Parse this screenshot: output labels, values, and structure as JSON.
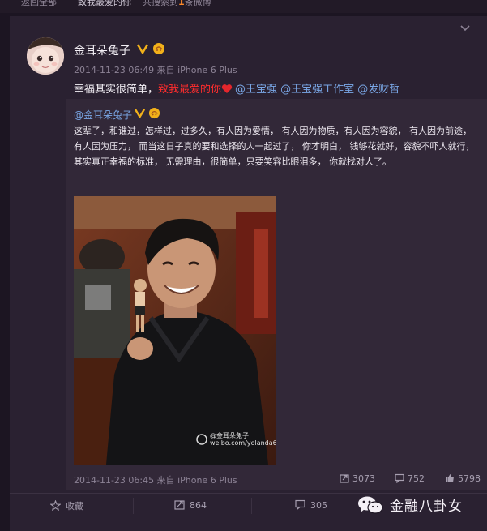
{
  "topbar": {
    "back_label": "返回全部",
    "crumb": "致我最爱的你",
    "count_prefix": "共搜索到",
    "count_value": "1",
    "count_suffix": "条微博"
  },
  "post": {
    "author": "金耳朵兔子",
    "meta": "2014-11-23 06:49 来自 iPhone 6 Plus",
    "text_plain": "幸福其实很简单，",
    "text_highlight": "致我最爱的你",
    "mentions": "@王宝强 @王宝强工作室 @发财哲"
  },
  "repost": {
    "author": "@金耳朵兔子",
    "text": "这辈子，和谁过，怎样过，过多久，有人因为爱情， 有人因为物质，有人因为容貌， 有人因为前途，有人因为压力， 而当这日子真的要和选择的人一起过了， 你才明白， 钱够花就好，容貌不吓人就行， 其实真正幸福的标准， 无需理由，很简单，只要笑容比眼泪多， 你就找对人了。",
    "photo_watermark_line1": "@金耳朵兔子",
    "photo_watermark_line2": "weibo.com/yolanda6",
    "meta": "2014-11-23 06:45 来自 iPhone 6 Plus",
    "reposts": "3073",
    "comments": "752",
    "likes": "5798"
  },
  "actions": {
    "favorite": "收藏",
    "repost_count": "864",
    "comment_count": "305"
  },
  "watermark": {
    "text": "金融八卦女"
  },
  "colors": {
    "background": "#1c1522",
    "card": "#2a2131",
    "repost_bg": "#322838",
    "highlight_red": "#ff2d2d",
    "link_blue": "#7aa7e6",
    "verified_gold": "#f2b11a"
  }
}
